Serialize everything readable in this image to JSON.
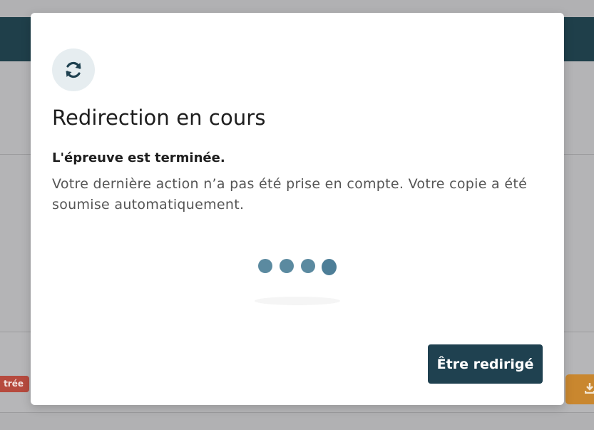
{
  "modal": {
    "title": "Redirection en cours",
    "subtitle": "L'épreuve est terminée.",
    "message": "Votre dernière action n’a pas été prise en compte. Votre copie a été soumise automatiquement.",
    "icon": "refresh-icon",
    "loader_icon": "loading-dots",
    "button_label": "Être redirigé"
  },
  "background": {
    "badge_text": "trée",
    "download_icon": "download-icon"
  },
  "colors": {
    "header": "#1f3f4a",
    "button": "#1f4150",
    "loader_dot": "#5b8aa0",
    "badge": "#b64a3e",
    "download": "#c9872f"
  }
}
